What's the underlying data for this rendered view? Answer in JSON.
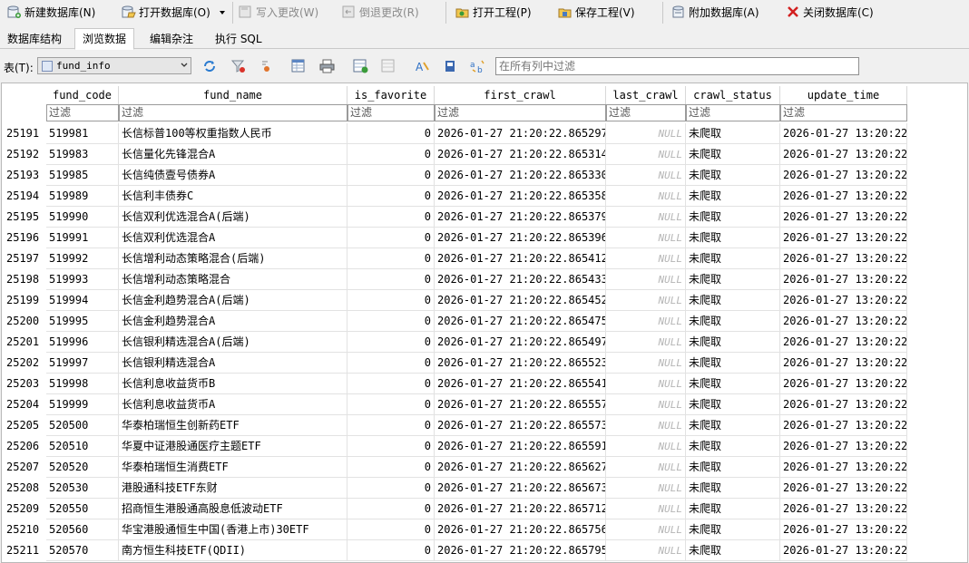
{
  "toolbar": {
    "new_db": "新建数据库(N)",
    "open_db": "打开数据库(O)",
    "write_changes": "写入更改(W)",
    "revert_changes": "倒退更改(R)",
    "open_project": "打开工程(P)",
    "save_project": "保存工程(V)",
    "attach_db": "附加数据库(A)",
    "close_db": "关闭数据库(C)"
  },
  "tabs": [
    "数据库结构",
    "浏览数据",
    "编辑杂注",
    "执行 SQL"
  ],
  "table_bar": {
    "label": "表(T):",
    "selected_table": "fund_info",
    "filter_placeholder": "在所有列中过滤"
  },
  "columns": [
    "fund_code",
    "fund_name",
    "is_favorite",
    "first_crawl",
    "last_crawl",
    "crawl_status",
    "update_time"
  ],
  "filter_placeholder": "过滤",
  "rows": [
    {
      "rn": "25191",
      "code": "519981",
      "name": "长信标普100等权重指数人民币",
      "fav": "0",
      "first": "2026-01-27 21:20:22.865297",
      "last": "NULL",
      "status": "未爬取",
      "update": "2026-01-27 13:20:22"
    },
    {
      "rn": "25192",
      "code": "519983",
      "name": "长信量化先锋混合A",
      "fav": "0",
      "first": "2026-01-27 21:20:22.865314",
      "last": "NULL",
      "status": "未爬取",
      "update": "2026-01-27 13:20:22"
    },
    {
      "rn": "25193",
      "code": "519985",
      "name": "长信纯债壹号债券A",
      "fav": "0",
      "first": "2026-01-27 21:20:22.865330",
      "last": "NULL",
      "status": "未爬取",
      "update": "2026-01-27 13:20:22"
    },
    {
      "rn": "25194",
      "code": "519989",
      "name": "长信利丰债券C",
      "fav": "0",
      "first": "2026-01-27 21:20:22.865358",
      "last": "NULL",
      "status": "未爬取",
      "update": "2026-01-27 13:20:22"
    },
    {
      "rn": "25195",
      "code": "519990",
      "name": "长信双利优选混合A(后端)",
      "fav": "0",
      "first": "2026-01-27 21:20:22.865379",
      "last": "NULL",
      "status": "未爬取",
      "update": "2026-01-27 13:20:22"
    },
    {
      "rn": "25196",
      "code": "519991",
      "name": "长信双利优选混合A",
      "fav": "0",
      "first": "2026-01-27 21:20:22.865396",
      "last": "NULL",
      "status": "未爬取",
      "update": "2026-01-27 13:20:22"
    },
    {
      "rn": "25197",
      "code": "519992",
      "name": "长信增利动态策略混合(后端)",
      "fav": "0",
      "first": "2026-01-27 21:20:22.865412",
      "last": "NULL",
      "status": "未爬取",
      "update": "2026-01-27 13:20:22"
    },
    {
      "rn": "25198",
      "code": "519993",
      "name": "长信增利动态策略混合",
      "fav": "0",
      "first": "2026-01-27 21:20:22.865433",
      "last": "NULL",
      "status": "未爬取",
      "update": "2026-01-27 13:20:22"
    },
    {
      "rn": "25199",
      "code": "519994",
      "name": "长信金利趋势混合A(后端)",
      "fav": "0",
      "first": "2026-01-27 21:20:22.865452",
      "last": "NULL",
      "status": "未爬取",
      "update": "2026-01-27 13:20:22"
    },
    {
      "rn": "25200",
      "code": "519995",
      "name": "长信金利趋势混合A",
      "fav": "0",
      "first": "2026-01-27 21:20:22.865475",
      "last": "NULL",
      "status": "未爬取",
      "update": "2026-01-27 13:20:22"
    },
    {
      "rn": "25201",
      "code": "519996",
      "name": "长信银利精选混合A(后端)",
      "fav": "0",
      "first": "2026-01-27 21:20:22.865497",
      "last": "NULL",
      "status": "未爬取",
      "update": "2026-01-27 13:20:22"
    },
    {
      "rn": "25202",
      "code": "519997",
      "name": "长信银利精选混合A",
      "fav": "0",
      "first": "2026-01-27 21:20:22.865523",
      "last": "NULL",
      "status": "未爬取",
      "update": "2026-01-27 13:20:22"
    },
    {
      "rn": "25203",
      "code": "519998",
      "name": "长信利息收益货币B",
      "fav": "0",
      "first": "2026-01-27 21:20:22.865541",
      "last": "NULL",
      "status": "未爬取",
      "update": "2026-01-27 13:20:22"
    },
    {
      "rn": "25204",
      "code": "519999",
      "name": "长信利息收益货币A",
      "fav": "0",
      "first": "2026-01-27 21:20:22.865557",
      "last": "NULL",
      "status": "未爬取",
      "update": "2026-01-27 13:20:22"
    },
    {
      "rn": "25205",
      "code": "520500",
      "name": "华泰柏瑞恒生创新药ETF",
      "fav": "0",
      "first": "2026-01-27 21:20:22.865573",
      "last": "NULL",
      "status": "未爬取",
      "update": "2026-01-27 13:20:22"
    },
    {
      "rn": "25206",
      "code": "520510",
      "name": "华夏中证港股通医疗主题ETF",
      "fav": "0",
      "first": "2026-01-27 21:20:22.865591",
      "last": "NULL",
      "status": "未爬取",
      "update": "2026-01-27 13:20:22"
    },
    {
      "rn": "25207",
      "code": "520520",
      "name": "华泰柏瑞恒生消费ETF",
      "fav": "0",
      "first": "2026-01-27 21:20:22.865627",
      "last": "NULL",
      "status": "未爬取",
      "update": "2026-01-27 13:20:22"
    },
    {
      "rn": "25208",
      "code": "520530",
      "name": "港股通科技ETF东财",
      "fav": "0",
      "first": "2026-01-27 21:20:22.865673",
      "last": "NULL",
      "status": "未爬取",
      "update": "2026-01-27 13:20:22"
    },
    {
      "rn": "25209",
      "code": "520550",
      "name": "招商恒生港股通高股息低波动ETF",
      "fav": "0",
      "first": "2026-01-27 21:20:22.865712",
      "last": "NULL",
      "status": "未爬取",
      "update": "2026-01-27 13:20:22"
    },
    {
      "rn": "25210",
      "code": "520560",
      "name": "华宝港股通恒生中国(香港上市)30ETF",
      "fav": "0",
      "first": "2026-01-27 21:20:22.865756",
      "last": "NULL",
      "status": "未爬取",
      "update": "2026-01-27 13:20:22"
    },
    {
      "rn": "25211",
      "code": "520570",
      "name": "南方恒生科技ETF(QDII)",
      "fav": "0",
      "first": "2026-01-27 21:20:22.865795",
      "last": "NULL",
      "status": "未爬取",
      "update": "2026-01-27 13:20:22"
    }
  ]
}
